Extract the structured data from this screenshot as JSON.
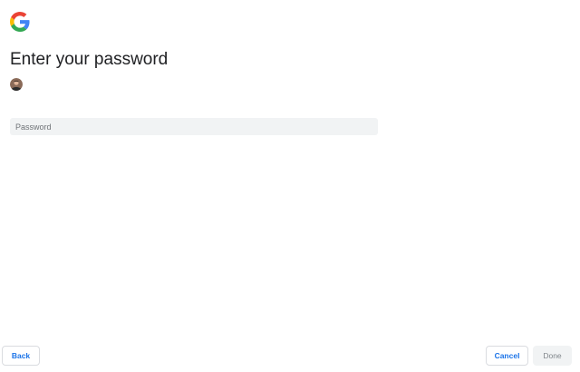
{
  "header": {
    "logo_icon": "google-g-logo-icon",
    "title": "Enter your password",
    "avatar_icon": "user-avatar-icon"
  },
  "form": {
    "password_placeholder": "Password",
    "password_value": ""
  },
  "footer": {
    "back_label": "Back",
    "cancel_label": "Cancel",
    "done_label": "Done",
    "done_enabled": false
  },
  "colors": {
    "accent": "#1a73e8",
    "field_background": "#f1f3f4",
    "disabled_text": "#80868b",
    "title_text": "#202124"
  }
}
